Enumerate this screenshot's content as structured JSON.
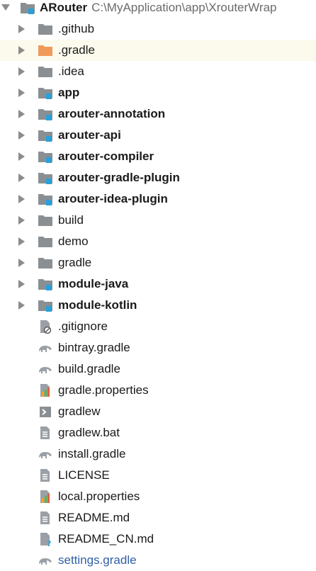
{
  "root": {
    "name": "ARouter",
    "path": "C:\\MyApplication\\app\\XrouterWrap"
  },
  "items": [
    {
      "label": ".github",
      "kind": "folder",
      "bold": false
    },
    {
      "label": ".gradle",
      "kind": "folder-orange",
      "bold": false,
      "selected": true
    },
    {
      "label": ".idea",
      "kind": "folder",
      "bold": false
    },
    {
      "label": "app",
      "kind": "module",
      "bold": true
    },
    {
      "label": "arouter-annotation",
      "kind": "module",
      "bold": true
    },
    {
      "label": "arouter-api",
      "kind": "module",
      "bold": true
    },
    {
      "label": "arouter-compiler",
      "kind": "module",
      "bold": true
    },
    {
      "label": "arouter-gradle-plugin",
      "kind": "module",
      "bold": true
    },
    {
      "label": "arouter-idea-plugin",
      "kind": "module",
      "bold": true
    },
    {
      "label": "build",
      "kind": "folder",
      "bold": false
    },
    {
      "label": "demo",
      "kind": "folder",
      "bold": false
    },
    {
      "label": "gradle",
      "kind": "folder",
      "bold": false
    },
    {
      "label": "module-java",
      "kind": "module",
      "bold": true
    },
    {
      "label": "module-kotlin",
      "kind": "module",
      "bold": true
    },
    {
      "label": ".gitignore",
      "kind": "file-ignore",
      "bold": false
    },
    {
      "label": "bintray.gradle",
      "kind": "gradle",
      "bold": false
    },
    {
      "label": "build.gradle",
      "kind": "gradle",
      "bold": false
    },
    {
      "label": "gradle.properties",
      "kind": "properties",
      "bold": false
    },
    {
      "label": "gradlew",
      "kind": "shell",
      "bold": false
    },
    {
      "label": "gradlew.bat",
      "kind": "text",
      "bold": false
    },
    {
      "label": "install.gradle",
      "kind": "gradle",
      "bold": false
    },
    {
      "label": "LICENSE",
      "kind": "text",
      "bold": false
    },
    {
      "label": "local.properties",
      "kind": "properties",
      "bold": false
    },
    {
      "label": "README.md",
      "kind": "text",
      "bold": false
    },
    {
      "label": "README_CN.md",
      "kind": "unknown",
      "bold": false
    },
    {
      "label": "settings.gradle",
      "kind": "gradle",
      "bold": false,
      "link": true
    }
  ],
  "colors": {
    "folder": "#8a8f93",
    "folder_orange": "#f09a5a",
    "module_badge": "#2aa0d8",
    "selection": "#fcfaed",
    "link": "#2f5fa8"
  }
}
